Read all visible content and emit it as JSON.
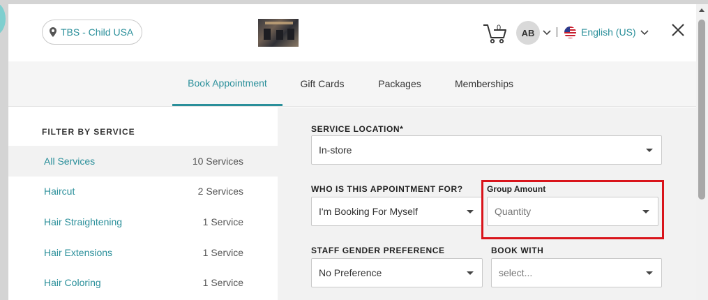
{
  "header": {
    "location_label": "TBS - Child USA",
    "cart_count": "0",
    "avatar_initials": "AB",
    "language_label": "English (US)"
  },
  "tabs": [
    {
      "label": "Book Appointment",
      "active": true
    },
    {
      "label": "Gift Cards",
      "active": false
    },
    {
      "label": "Packages",
      "active": false
    },
    {
      "label": "Memberships",
      "active": false
    }
  ],
  "sidebar": {
    "title": "FILTER BY SERVICE",
    "items": [
      {
        "name": "All Services",
        "count": "10 Services",
        "active": true
      },
      {
        "name": "Haircut",
        "count": "2 Services",
        "active": false
      },
      {
        "name": "Hair Straightening",
        "count": "1 Service",
        "active": false
      },
      {
        "name": "Hair Extensions",
        "count": "1 Service",
        "active": false
      },
      {
        "name": "Hair Coloring",
        "count": "1 Service",
        "active": false
      }
    ]
  },
  "form": {
    "service_location": {
      "label": "SERVICE LOCATION*",
      "value": "In-store"
    },
    "appointment_for": {
      "label": "WHO IS THIS APPOINTMENT FOR?",
      "value": "I'm Booking For Myself"
    },
    "group_amount": {
      "label": "Group Amount",
      "placeholder": "Quantity"
    },
    "staff_gender": {
      "label": "STAFF GENDER PREFERENCE",
      "value": "No Preference"
    },
    "book_with": {
      "label": "BOOK WITH",
      "placeholder": "select..."
    }
  },
  "colors": {
    "accent": "#2a8f9a",
    "highlight": "#d9141b"
  }
}
